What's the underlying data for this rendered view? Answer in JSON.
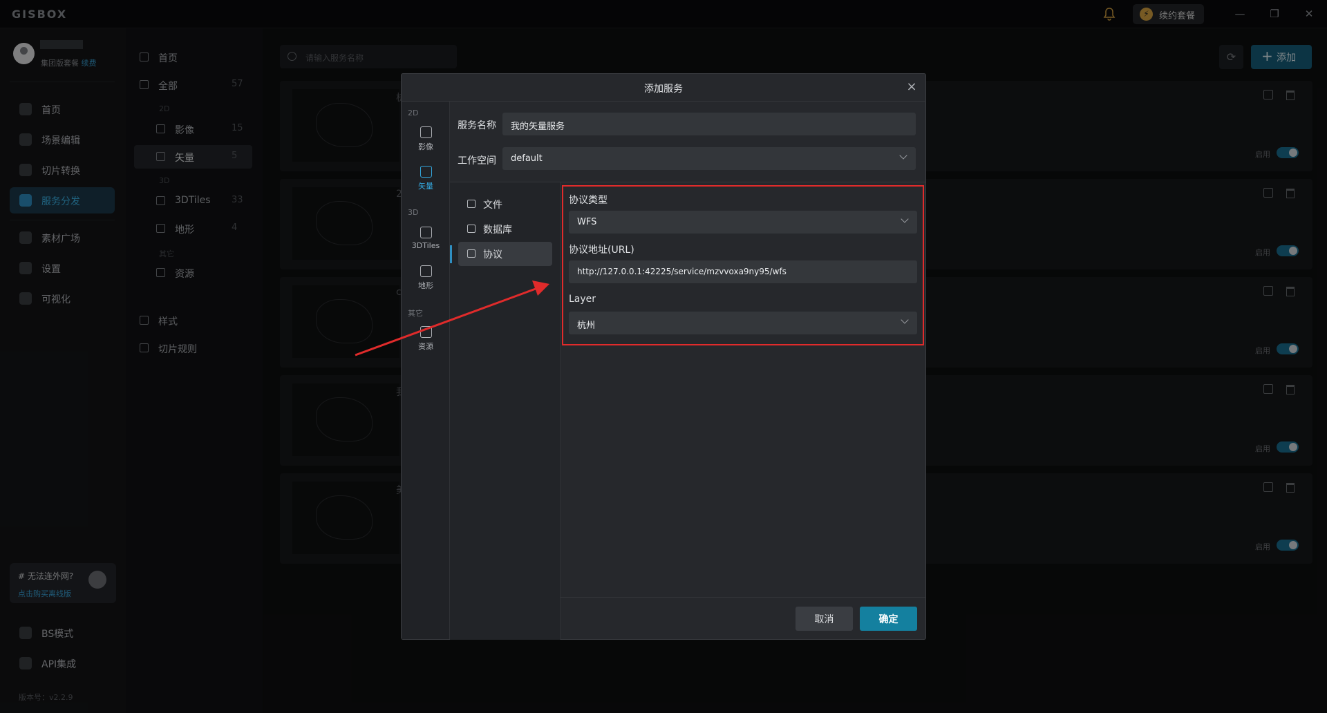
{
  "app": {
    "logo": "GISBOX",
    "renew_label": "续约套餐",
    "notif_icon": "bell-icon"
  },
  "user": {
    "plan": "集团版套餐",
    "renew_link": "续费"
  },
  "sidebar": {
    "items": [
      {
        "label": "首页",
        "icon": "home-icon"
      },
      {
        "label": "场景编辑",
        "icon": "cube-icon"
      },
      {
        "label": "切片转换",
        "icon": "convert-icon"
      },
      {
        "label": "服务分发",
        "icon": "upload-cloud-icon"
      },
      {
        "label": "素材广场",
        "icon": "image-icon"
      },
      {
        "label": "设置",
        "icon": "gear-icon"
      },
      {
        "label": "可视化",
        "icon": "chart-icon"
      }
    ],
    "promo": {
      "title": "# 无法连外网?",
      "link": "点击购买离线版"
    },
    "bottom": [
      {
        "label": "BS模式",
        "icon": "code-icon"
      },
      {
        "label": "API集成",
        "icon": "api-icon"
      }
    ],
    "version": "版本号：v2.2.9"
  },
  "categories": {
    "home": "首页",
    "all": "全部",
    "all_count": "57",
    "group_2d": "2D",
    "imagery": "影像",
    "imagery_count": "15",
    "vector": "矢量",
    "vector_count": "5",
    "group_3d": "3D",
    "tiles3d": "3DTiles",
    "tiles3d_count": "33",
    "terrain": "地形",
    "terrain_count": "4",
    "group_other": "其它",
    "resource": "资源",
    "style": "样式",
    "tile_rule": "切片规则"
  },
  "main": {
    "search_placeholder": "请输入服务名称",
    "add_label": "添加",
    "enable_label": "启用",
    "cards": [
      {
        "title": "杭"
      },
      {
        "title": "2"
      },
      {
        "title": "c"
      },
      {
        "title": "我"
      },
      {
        "title": "美"
      }
    ]
  },
  "dialog": {
    "title": "添加服务",
    "vtabs": {
      "label_2d": "2D",
      "imagery": "影像",
      "vector": "矢量",
      "label_3d": "3D",
      "tiles3d": "3DTiles",
      "terrain": "地形",
      "label_other": "其它",
      "resource": "资源"
    },
    "name_label": "服务名称",
    "name_value": "我的矢量服务",
    "workspace_label": "工作空间",
    "workspace_value": "default",
    "source_menu": [
      "文件",
      "数据库",
      "协议"
    ],
    "protocol_type_label": "协议类型",
    "protocol_type_value": "WFS",
    "protocol_url_label": "协议地址(URL)",
    "protocol_url_value": "http://127.0.0.1:42225/service/mzvvoxa9ny95/wfs",
    "layer_label": "Layer",
    "layer_value": "杭州",
    "cancel": "取消",
    "ok": "确定"
  },
  "colors": {
    "accent": "#14809f",
    "highlight_box": "#e02b2b",
    "arrow": "#e02b2b"
  }
}
